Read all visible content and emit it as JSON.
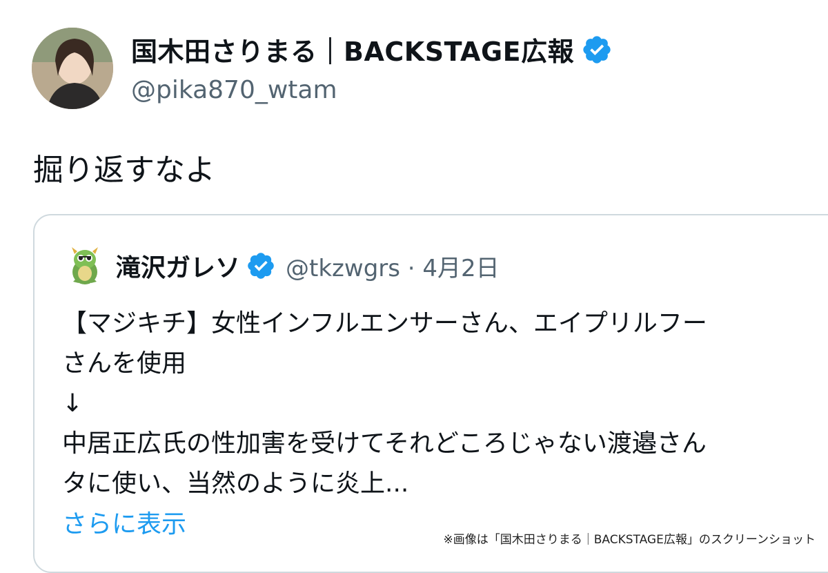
{
  "author": {
    "display_name": "国木田さりまる｜BACKSTAGE広報",
    "handle": "@pika870_wtam",
    "verified_color": "#1d9bf0"
  },
  "tweet": {
    "text": "掘り返すなよ"
  },
  "quoted_tweet": {
    "display_name": "滝沢ガレソ",
    "handle_and_date": "@tkzwgrs · 4月2日",
    "body_lines": [
      "【マジキチ】女性インフルエンサーさん、エイプリルフー",
      "さんを使用",
      "↓",
      "中居正広氏の性加害を受けてそれどころじゃない渡邉さん",
      "タに使い、当然のように炎上..."
    ],
    "show_more": "さらに表示"
  },
  "caption": "※画像は「国木田さりまる｜BACKSTAGE広報」のスクリーンショット",
  "icons": {
    "author_avatar": "avatar",
    "verified": "verified-badge-icon",
    "quote_avatar": "dragon-avatar"
  },
  "colors": {
    "text": "#0f1419",
    "secondary": "#536471",
    "link": "#1d9bf0",
    "border": "#cfd9de"
  }
}
